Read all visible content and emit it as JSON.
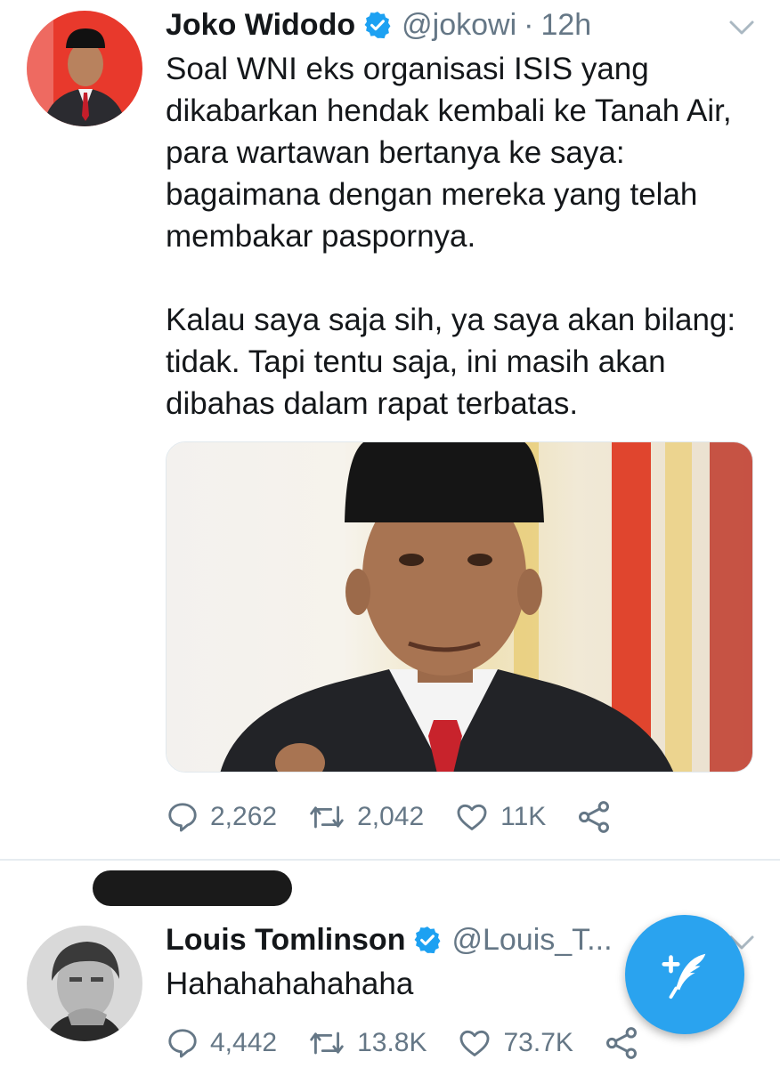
{
  "tweet1": {
    "display_name": "Joko Widodo",
    "handle": "@jokowi",
    "separator": "·",
    "time": "12h",
    "paragraph1": "Soal WNI eks organisasi ISIS yang dikabarkan hendak kembali ke Tanah Air, para wartawan bertanya ke saya: bagaimana dengan mereka yang telah membakar paspornya.",
    "paragraph2": "Kalau saya saja sih, ya saya akan bilang: tidak. Tapi tentu saja, ini masih akan dibahas dalam rapat terbatas.",
    "replies": "2,262",
    "retweets": "2,042",
    "likes": "11K"
  },
  "tweet2": {
    "display_name": "Louis Tomlinson",
    "handle": "@Louis_T...",
    "text": "Hahahahahahaha",
    "replies": "4,442",
    "retweets": "13.8K",
    "likes": "73.7K"
  },
  "colors": {
    "accent": "#1da1f2",
    "fab": "#2aa3ef",
    "secondary_text": "#657786"
  },
  "icons": [
    "verified-icon",
    "chevron-down-icon",
    "reply-icon",
    "retweet-icon",
    "like-icon",
    "share-icon",
    "compose-icon"
  ]
}
